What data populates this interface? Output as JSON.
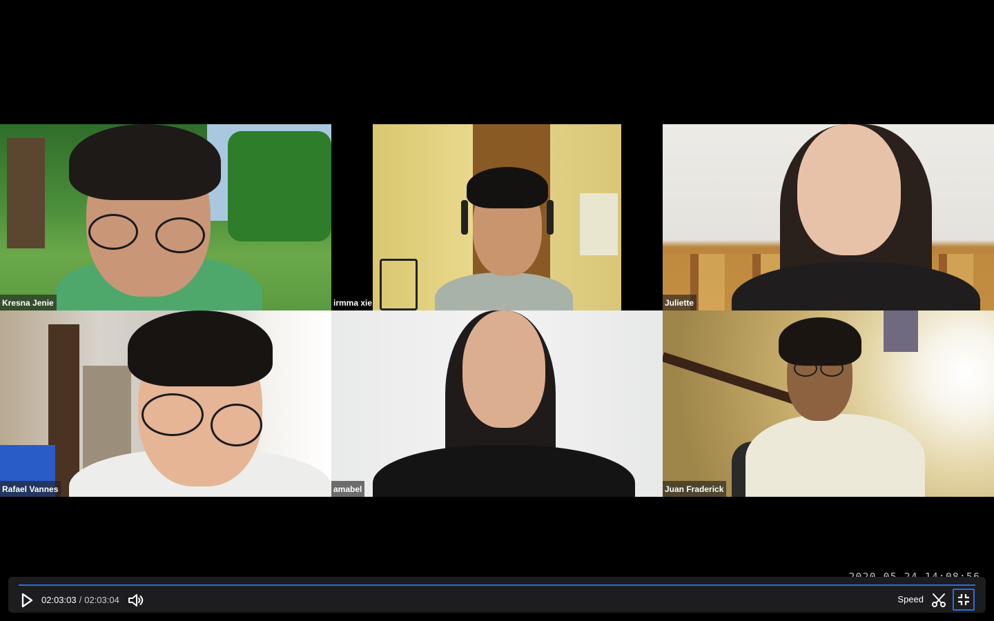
{
  "participants": [
    {
      "name": "Kresna Jenie"
    },
    {
      "name": "irmma xie"
    },
    {
      "name": "Juliette"
    },
    {
      "name": "Rafael Vannes"
    },
    {
      "name": "amabel"
    },
    {
      "name": "Juan Fraderick"
    }
  ],
  "recording": {
    "timestamp": "2020-05-24 14:08:56"
  },
  "player": {
    "current_time": "02:03:03",
    "separator": "/",
    "duration": "02:03:04",
    "progress_fraction": 0.9999,
    "speed_label": "Speed",
    "icons": {
      "play": "play-icon",
      "volume": "volume-icon",
      "clip": "scissors-icon",
      "fullscreen": "exit-fullscreen-icon"
    },
    "accent_color": "#2f6be0"
  }
}
